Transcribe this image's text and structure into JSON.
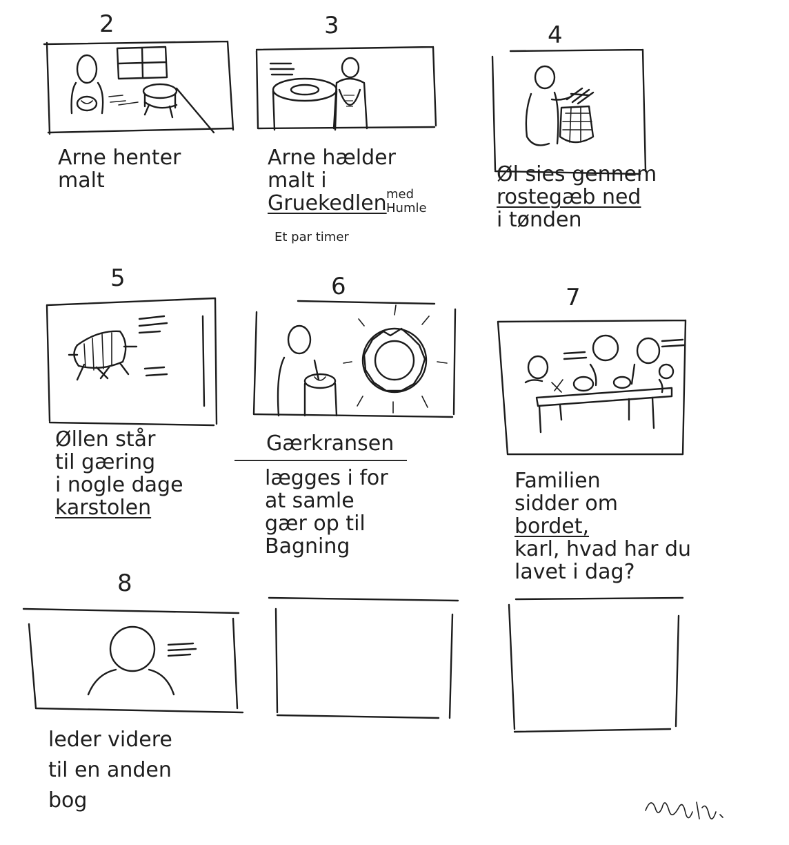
{
  "panels": [
    {
      "number": "2",
      "caption": [
        "Arne henter",
        "malt"
      ]
    },
    {
      "number": "3",
      "caption": [
        "Arne hælder",
        "malt i",
        "Gruekedlen"
      ],
      "note_with": "med Humle",
      "note_time": "Et par timer"
    },
    {
      "number": "4",
      "caption": [
        "Øl sies gennem",
        "rostegæb ned",
        "i tønden"
      ]
    },
    {
      "number": "5",
      "caption": [
        "Øllen står",
        "til gæring",
        "i nogle dage",
        "karstolen"
      ]
    },
    {
      "number": "6",
      "caption_title": "Gærkransen",
      "caption": [
        "lægges i for",
        "at samle",
        "gær op til",
        "Bagning"
      ]
    },
    {
      "number": "7",
      "caption": [
        "Familien",
        "sidder om",
        "bordet,",
        "karl, hvad har du",
        "lavet i dag?"
      ]
    },
    {
      "number": "8",
      "caption": [
        "leder videre",
        "til en anden",
        "bog"
      ]
    },
    {
      "number": "",
      "caption": []
    },
    {
      "number": "",
      "caption": []
    }
  ],
  "signature": "elg"
}
